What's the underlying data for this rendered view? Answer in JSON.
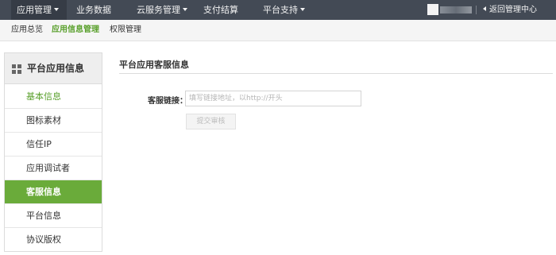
{
  "topnav": {
    "items": [
      {
        "label": "应用管理",
        "has_caret": true,
        "active": true
      },
      {
        "label": "业务数据",
        "has_caret": false,
        "active": false
      },
      {
        "label": "云服务管理",
        "has_caret": true,
        "active": false
      },
      {
        "label": "支付结算",
        "has_caret": false,
        "active": false
      },
      {
        "label": "平台支持",
        "has_caret": true,
        "active": false
      }
    ],
    "back_label": "返回管理中心"
  },
  "subnav": {
    "items": [
      {
        "label": "应用总览",
        "active": false
      },
      {
        "label": "应用信息管理",
        "active": true
      },
      {
        "label": "权限管理",
        "active": false
      }
    ]
  },
  "sidebar": {
    "title": "平台应用信息",
    "items": [
      {
        "label": "基本信息"
      },
      {
        "label": "图标素材"
      },
      {
        "label": "信任IP"
      },
      {
        "label": "应用调试者"
      },
      {
        "label": "客服信息",
        "active": true
      },
      {
        "label": "平台信息"
      },
      {
        "label": "协议版权"
      }
    ]
  },
  "main": {
    "title": "平台应用客服信息",
    "field_label": "客服链接：",
    "field_value": "",
    "field_placeholder": "填写链接地址，以http://开头",
    "submit_label": "提交审核"
  },
  "colors": {
    "nav_bg": "#434a55",
    "accent_green": "#6aab3a",
    "active_text_green": "#5aa02c"
  }
}
